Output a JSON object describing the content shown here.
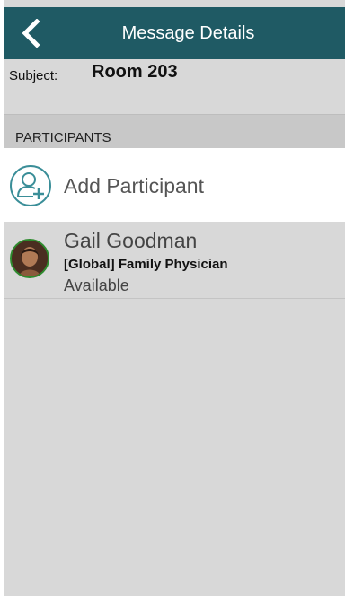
{
  "header": {
    "title": "Message Details",
    "back_icon": "chevron-left-icon"
  },
  "subject": {
    "label": "Subject:",
    "value": "Room 203"
  },
  "participants": {
    "section_label": "PARTICIPANTS",
    "add_label": "Add Participant",
    "add_icon": "add-user-icon",
    "items": [
      {
        "name": "Gail Goodman",
        "role": "[Global] Family Physician",
        "status": "Available",
        "status_color": "#2e8b2e"
      }
    ]
  },
  "colors": {
    "header_bg": "#1f5a64",
    "accent": "#3a8e98",
    "background": "#d8d8d8"
  }
}
